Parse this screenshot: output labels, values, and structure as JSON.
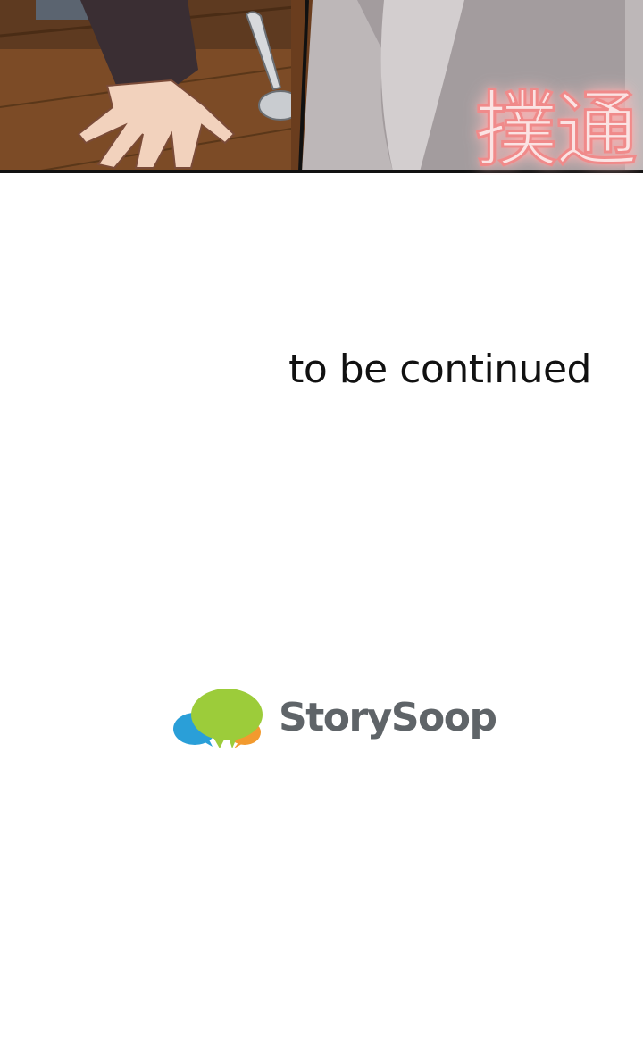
{
  "panel": {
    "sound_effect": "撲通",
    "colors": {
      "floor": "#7a4a25",
      "sleeve": "#3a2e33",
      "skin": "#f2d2bd",
      "wall": "#b9b3b4",
      "sfx_glow": "#f08a8a"
    }
  },
  "caption": {
    "text": "to be continued"
  },
  "publisher": {
    "name": "StorySoop",
    "icon": "speech-bubbles-logo-icon",
    "colors": {
      "green": "#9ccc3a",
      "blue": "#2a9fd8",
      "orange": "#f29a2e",
      "text": "#5f6468"
    }
  }
}
